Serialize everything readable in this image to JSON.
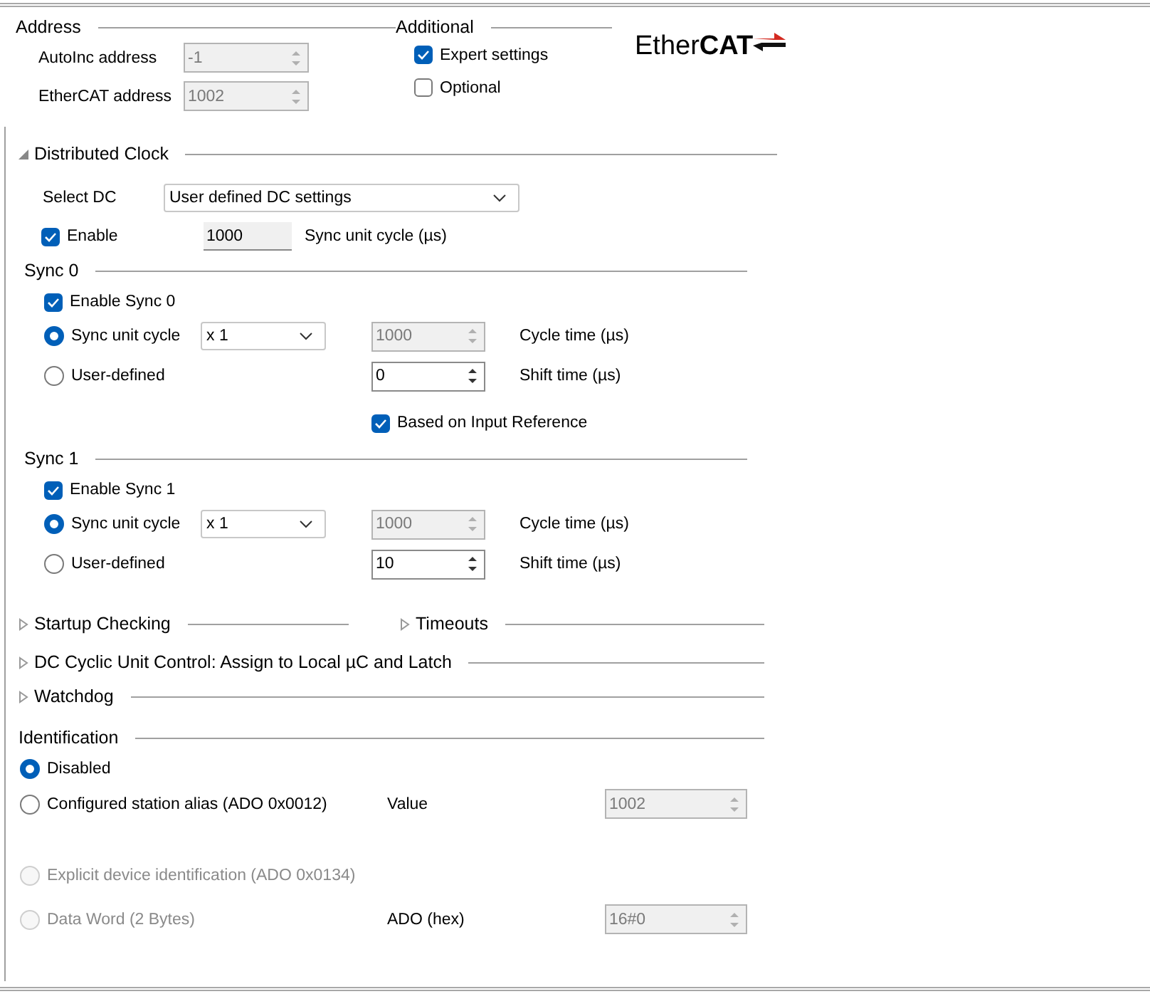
{
  "address": {
    "title": "Address",
    "fields": [
      {
        "label": "AutoInc address",
        "value": "-1",
        "disabled": true
      },
      {
        "label": "EtherCAT address",
        "value": "1002",
        "disabled": true
      }
    ]
  },
  "additional": {
    "title": "Additional",
    "options": [
      {
        "label": "Expert settings",
        "checked": true
      },
      {
        "label": "Optional",
        "checked": false
      }
    ]
  },
  "logo": "Ether**CAT**",
  "distributed_clock": {
    "title": "Distributed Clock",
    "expanded": true,
    "select_dc": {
      "label": "Select DC",
      "value": "User defined DC settings"
    },
    "enable": {
      "label": "Enable",
      "checked": true
    },
    "sync_unit_cycle": {
      "value": "1000",
      "label": "Sync unit cycle (µs)"
    },
    "syncs": [
      {
        "title": "Sync 0",
        "enable": {
          "label": "Enable Sync 0",
          "checked": true
        },
        "modes": [
          {
            "label": "Sync unit cycle",
            "selected": true
          },
          {
            "label": "User-defined",
            "selected": false
          }
        ],
        "multiplier": "x 1",
        "cycle_time": {
          "value": "1000",
          "label": "Cycle time (µs)",
          "disabled": true
        },
        "shift_time": {
          "value": "0",
          "label": "Shift time (µs)",
          "disabled": false
        },
        "input_reference": {
          "label": "Based on Input Reference",
          "checked": true
        }
      },
      {
        "title": "Sync 1",
        "enable": {
          "label": "Enable Sync 1",
          "checked": true
        },
        "modes": [
          {
            "label": "Sync unit cycle",
            "selected": true
          },
          {
            "label": "User-defined",
            "selected": false
          }
        ],
        "multiplier": "x 1",
        "cycle_time": {
          "value": "1000",
          "label": "Cycle time (µs)",
          "disabled": true
        },
        "shift_time": {
          "value": "10",
          "label": "Shift time (µs)",
          "disabled": false
        }
      }
    ]
  },
  "sections": [
    {
      "items": [
        {
          "title": "Startup Checking",
          "expanded": false
        },
        {
          "title": "Timeouts",
          "expanded": false
        }
      ]
    },
    {
      "items": [
        {
          "title": "DC Cyclic Unit Control: Assign to Local µC and Latch",
          "expanded": false
        }
      ]
    },
    {
      "items": [
        {
          "title": "Watchdog",
          "expanded": false
        }
      ]
    }
  ],
  "identification": {
    "title": "Identification",
    "options": [
      {
        "label": "Disabled",
        "selected": true,
        "disabled": false
      },
      {
        "label": "Configured station alias (ADO 0x0012)",
        "selected": false,
        "disabled": false,
        "field_label": "Value",
        "field_value": "1002"
      },
      {
        "label": "Explicit device identification (ADO 0x0134)",
        "selected": false,
        "disabled": true
      },
      {
        "label": "Data Word (2 Bytes)",
        "selected": false,
        "disabled": true,
        "field_label": "ADO (hex)",
        "field_value": "16#0"
      }
    ]
  }
}
